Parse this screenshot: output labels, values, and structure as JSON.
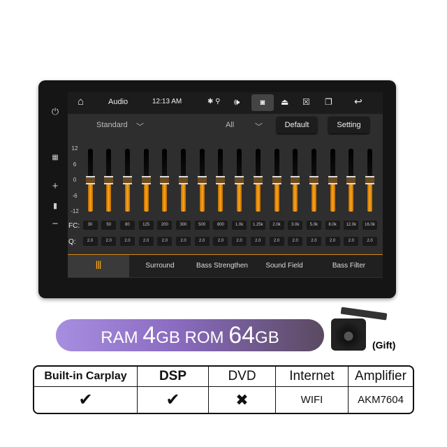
{
  "status": {
    "app": "Audio",
    "time": "12:13 AM"
  },
  "controls": {
    "preset": "Standard",
    "channel": "All",
    "default_label": "Default",
    "setting_label": "Setting"
  },
  "eq": {
    "y_ticks": [
      "12",
      "6",
      "0",
      "-6",
      "-12"
    ],
    "fc_label": "FC:",
    "q_label": "Q:",
    "bands": [
      {
        "fc": "30",
        "q": "2.0",
        "gain": 0
      },
      {
        "fc": "50",
        "q": "2.0",
        "gain": 0
      },
      {
        "fc": "80",
        "q": "2.0",
        "gain": 0
      },
      {
        "fc": "125",
        "q": "2.0",
        "gain": 0
      },
      {
        "fc": "200",
        "q": "2.0",
        "gain": 0
      },
      {
        "fc": "300",
        "q": "2.0",
        "gain": 0
      },
      {
        "fc": "500",
        "q": "2.0",
        "gain": 0
      },
      {
        "fc": "800",
        "q": "2.0",
        "gain": 0
      },
      {
        "fc": "1.0k",
        "q": "2.0",
        "gain": 0
      },
      {
        "fc": "1.25k",
        "q": "2.0",
        "gain": 0
      },
      {
        "fc": "2.0k",
        "q": "2.0",
        "gain": 0
      },
      {
        "fc": "3.0k",
        "q": "2.0",
        "gain": 0
      },
      {
        "fc": "5.0k",
        "q": "2.0",
        "gain": 0
      },
      {
        "fc": "8.0k",
        "q": "2.0",
        "gain": 0
      },
      {
        "fc": "12.0k",
        "q": "2.0",
        "gain": 0
      },
      {
        "fc": "16.0k",
        "q": "2.0",
        "gain": 0
      }
    ]
  },
  "tabs": [
    "Surround",
    "Bass Strengthen",
    "Sound Field",
    "Bass Filter"
  ],
  "promo": {
    "ram_label": "RAM",
    "ram": "4",
    "ram_unit": "GB",
    "rom_label": "ROM",
    "rom": "64",
    "rom_unit": "GB",
    "gift": "(Gift)"
  },
  "table": {
    "headers": [
      "Built-in Carplay",
      "DSP",
      "DVD",
      "Internet",
      "Amplifier"
    ],
    "values": [
      "✔",
      "✔",
      "✖",
      "WIFI",
      "AKM7604"
    ]
  },
  "colors": {
    "accent": "#ffa51c"
  }
}
